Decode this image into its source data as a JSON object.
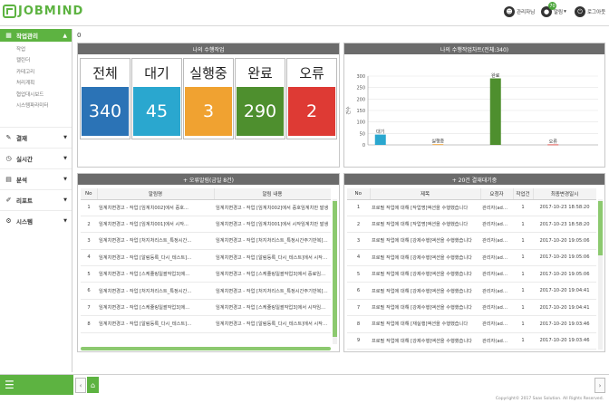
{
  "app": {
    "logo_text": "JOBMIND"
  },
  "topbar": {
    "user_label": "관리자님",
    "alarm_label": "알림",
    "alarm_arrow": "▾",
    "alarm_badge": "70",
    "logout_label": "로그아웃"
  },
  "sidebar": {
    "head": {
      "label": "작업관리",
      "arrow": "▲"
    },
    "sub_items": [
      "작업",
      "캘린더",
      "카테고리",
      "처리계획",
      "협업대시보드",
      "시스템파라미터"
    ],
    "menus": [
      {
        "label": "결재",
        "icon": "edit-icon",
        "arrow": "▼"
      },
      {
        "label": "실시간",
        "icon": "clock-icon",
        "arrow": "▼"
      },
      {
        "label": "분석",
        "icon": "chart-icon",
        "arrow": "▼"
      },
      {
        "label": "리포트",
        "icon": "paperclip-icon",
        "arrow": "▼"
      },
      {
        "label": "시스템",
        "icon": "gear-icon",
        "arrow": "▼"
      }
    ]
  },
  "breadcrumb": "0",
  "job_status": {
    "title": "나의 수행작업",
    "boxes": [
      {
        "label": "전체",
        "value": "340",
        "color": "#2b73b6"
      },
      {
        "label": "대기",
        "value": "45",
        "color": "#2aa7cf"
      },
      {
        "label": "실행중",
        "value": "3",
        "color": "#f0a231"
      },
      {
        "label": "완료",
        "value": "290",
        "color": "#4e8f2e"
      },
      {
        "label": "오류",
        "value": "2",
        "color": "#de3a34"
      }
    ]
  },
  "job_chart": {
    "title": "나의 수행작업차트(전체:340)",
    "ylabel": "건수",
    "chart_data": {
      "type": "bar",
      "categories": [
        "대기",
        "실행중",
        "완료",
        "오류"
      ],
      "values": [
        45,
        3,
        290,
        2
      ],
      "colors": [
        "#2aa7cf",
        "#f0a231",
        "#4e8f2e",
        "#de3a34"
      ],
      "ylim": [
        0,
        300
      ],
      "yticks": [
        0,
        50,
        100,
        150,
        200,
        250,
        300
      ],
      "ylabel": "건수",
      "grid": true
    }
  },
  "alarms": {
    "title": "+ 오류알림(금일 8건)",
    "headers": [
      "No",
      "알림명",
      "알림 내용"
    ],
    "rows": [
      [
        "1",
        "임계치변경고 - 작업 [임계치002]에서 중호...",
        "임계치변경고 - 작업 [임계치002]에서 중호임계치만 발생"
      ],
      [
        "2",
        "임계치변경고 - 작업 [임계치001]에서 시작...",
        "임계치변경고 - 작업 [임계치001]에서 시작임계치만 발생"
      ],
      [
        "3",
        "임계치변경고 - 작업 [처지처리스트_특정시간...",
        "임계치변경고 - 작업 [처지처리스트_특정시간주기반복]에서 수..."
      ],
      [
        "4",
        "임계치변경고 - 작업 [알림등록_다시_테스트]...",
        "임계치변경고 - 작업 [알림등록_다시_테스트]에서 시작임계만..."
      ],
      [
        "5",
        "임계치변경고 - 작업 [스케쥴링일괄작업3]에...",
        "임계치변경고 - 작업 [스케쥴링일괄작업3]에서 중료임계만 발..."
      ],
      [
        "6",
        "임계치변경고 - 작업 [처지처리스트_특정시간...",
        "임계치변경고 - 작업 [처지처리스트_특정시간주기반복]에서 수..."
      ],
      [
        "7",
        "임계치변경고 - 작업 [스케쥴링일괄작업3]에...",
        "임계치변경고 - 작업 [스케쥴링일괄작업3]에서 시작임계만 발..."
      ],
      [
        "8",
        "임계치변경고 - 작업 [알림등록_다시_테스트]...",
        "임계치변경고 - 작업 [알림등록_다시_테스트]에서 시작임계만..."
      ]
    ]
  },
  "approvals": {
    "title": "+ 20건 결재대기중",
    "headers": [
      "No",
      "제목",
      "요청자",
      "작업건",
      "최종변경일시"
    ],
    "rows": [
      [
        "1",
        "프로필 작업에 대해 [작업명]액션을 수행했습니다",
        "관리자(adm...",
        "1",
        "2017-10-23 18:58:20"
      ],
      [
        "2",
        "프로필 작업에 대해 [작업명]액션을 수행했습니다",
        "관리자(adm...",
        "1",
        "2017-10-23 18:58:20"
      ],
      [
        "3",
        "프로필 작업에 대해 [강제수행]액션을 수행했습니다",
        "관리자(adm...",
        "1",
        "2017-10-20 19:05:06"
      ],
      [
        "4",
        "프로필 작업에 대해 [강제수행]액션을 수행했습니다",
        "관리자(adm...",
        "1",
        "2017-10-20 19:05:06"
      ],
      [
        "5",
        "프로필 작업에 대해 [강제수행]액션을 수행했습니다",
        "관리자(adm...",
        "1",
        "2017-10-20 19:05:06"
      ],
      [
        "6",
        "프로필 작업에 대해 [강제수행]액션을 수행했습니다",
        "관리자(adm...",
        "1",
        "2017-10-20 19:04:41"
      ],
      [
        "7",
        "프로필 작업에 대해 [강제수행]액션을 수행했습니다",
        "관리자(adm...",
        "1",
        "2017-10-20 19:04:41"
      ],
      [
        "8",
        "프로필 작업에 대해 [재실행]액션을 수행했습니다",
        "관리자(adm...",
        "1",
        "2017-10-20 19:03:46"
      ],
      [
        "9",
        "프로필 작업에 대해 [강제수행]액션을 수행했습니다",
        "관리자(adm...",
        "1",
        "2017-10-20 19:03:46"
      ]
    ]
  },
  "footer": {
    "menu_icon": "☰",
    "prev": "‹",
    "home": "⌂",
    "next": "›",
    "copyright": "Copyright© 2017 Saas Solution. All Rights Reserved."
  }
}
